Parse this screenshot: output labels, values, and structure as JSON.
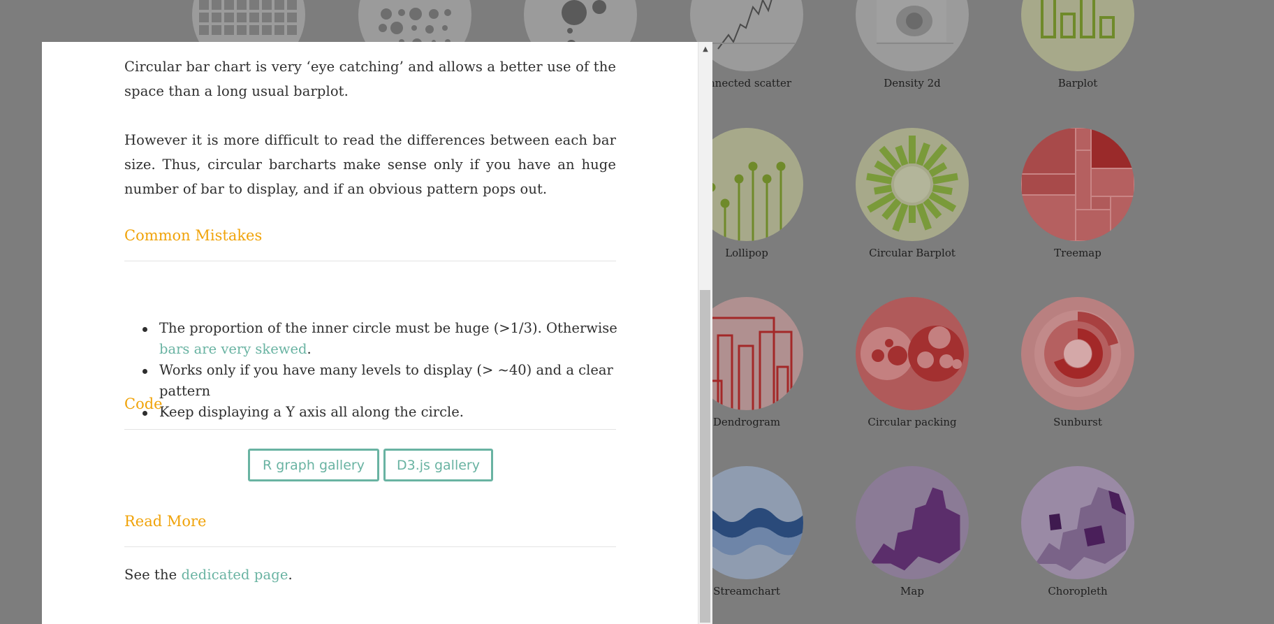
{
  "gallery": {
    "labels": {
      "connected_scatter": "onnected scatter",
      "density2d": "Density 2d",
      "barplot": "Barplot",
      "lollipop": "Lollipop",
      "circular_barplot": "Circular Barplot",
      "treemap": "Treemap",
      "dendrogram": "Dendrogram",
      "circular_packing": "Circular packing",
      "sunburst": "Sunburst",
      "streamchart": "Streamchart",
      "map": "Map",
      "choropleth": "Choropleth"
    },
    "colors": {
      "green": "#69b3a2",
      "olive": "#7a9a3a",
      "red": "#b52b2b",
      "purple": "#5b2e6b",
      "blue": "#2a4a7a",
      "dim_overlay": "#7d7d7d"
    }
  },
  "modal": {
    "intro_paragraph": "Circular bar chart is very ‘eye catching’ and allows a better use of the space than a long usual barplot.",
    "second_paragraph": "However it is more difficult to read the differences between each bar size. Thus, circular barcharts make sense only if you have an huge number of bar to display, and if an obvious pattern pops out.",
    "common_mistakes_title": "Common Mistakes",
    "mistakes": {
      "item1_text": "The proportion of the inner circle must be huge (>1/3). Otherwise ",
      "item1_link": "bars are very skewed",
      "item1_end": ".",
      "item2": "Works only if you have many levels to display (> ~40) and a clear pattern",
      "item3": "Keep displaying a Y axis all along the circle."
    },
    "code_title": "Code",
    "buttons": {
      "r_gallery": "R graph gallery",
      "d3_gallery": "D3.js gallery"
    },
    "read_more_title": "Read More",
    "read_more": {
      "prefix": "See the ",
      "link": "dedicated page",
      "suffix": "."
    },
    "accent_color": "#f0a30a",
    "link_color": "#69b3a2"
  },
  "scrollbar": {
    "up_arrow": "▲"
  }
}
